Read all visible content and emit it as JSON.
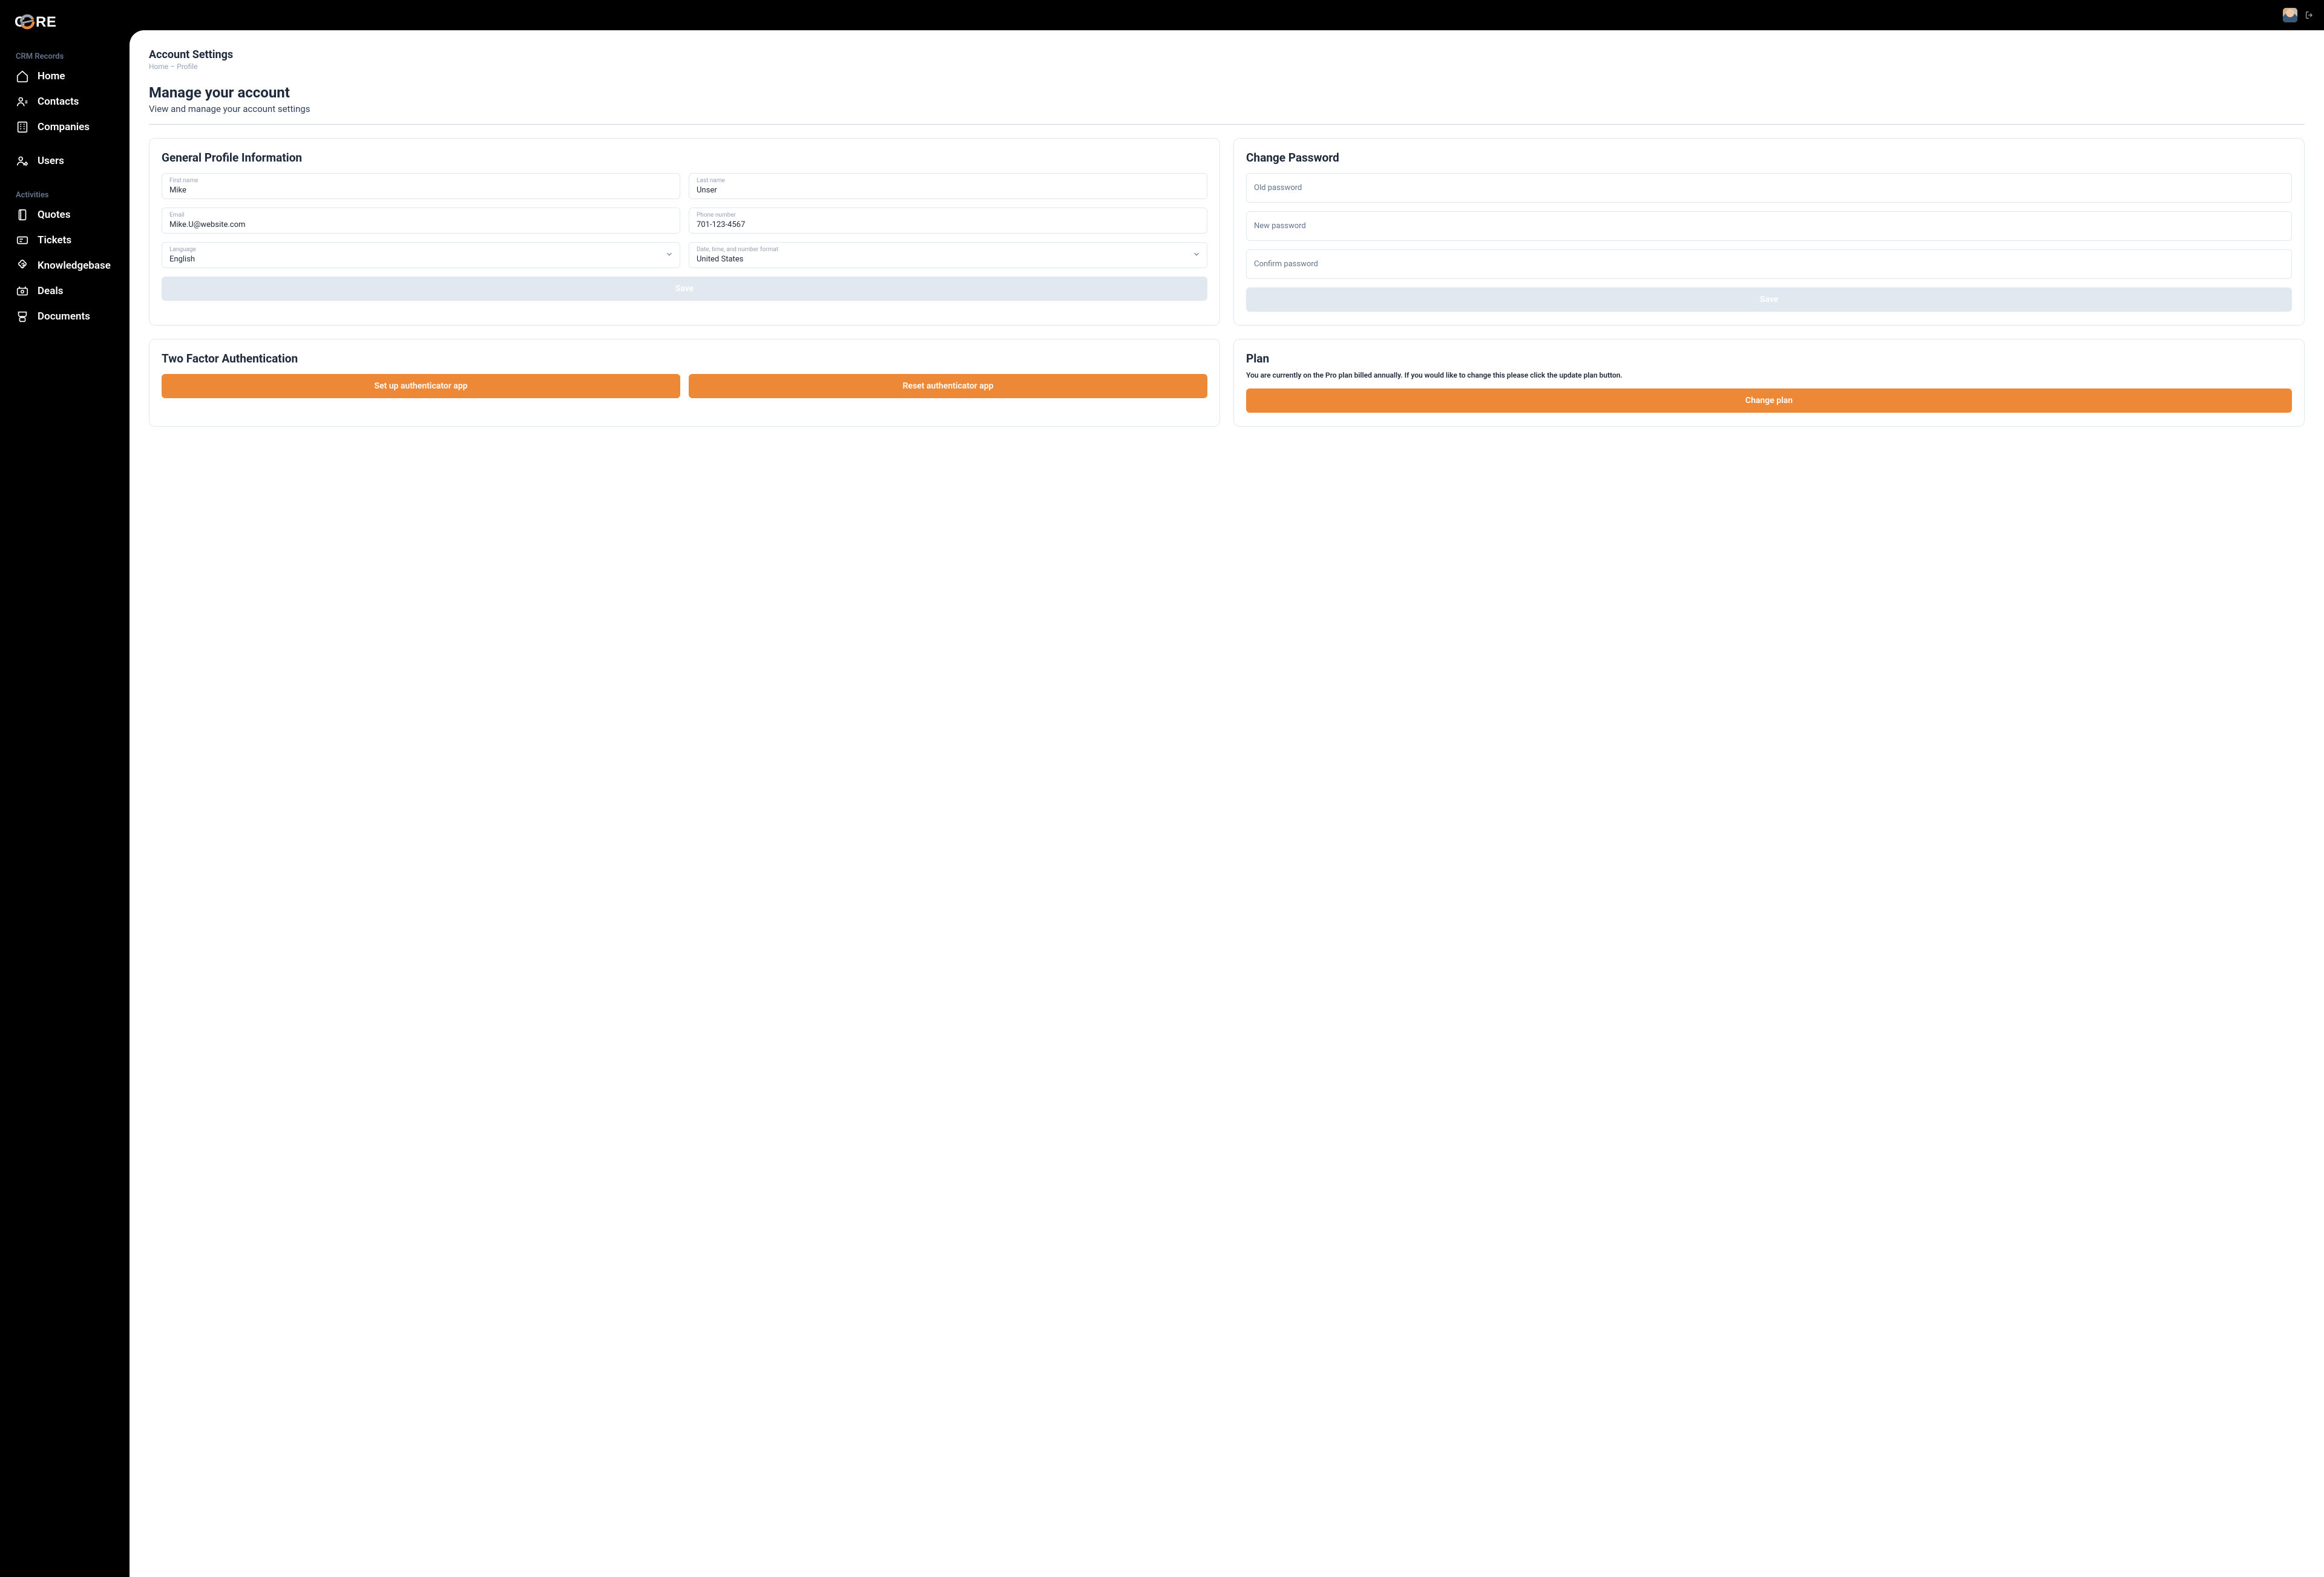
{
  "brand": {
    "name": "CORE"
  },
  "sidebar": {
    "section1_title": "CRM Records",
    "section2_title": "Activities",
    "items1": [
      {
        "label": "Home"
      },
      {
        "label": "Contacts"
      },
      {
        "label": "Companies"
      },
      {
        "label": "Users"
      }
    ],
    "items2": [
      {
        "label": "Quotes"
      },
      {
        "label": "Tickets"
      },
      {
        "label": "Knowledgebase"
      },
      {
        "label": "Deals"
      },
      {
        "label": "Documents"
      }
    ]
  },
  "header": {
    "page_title": "Account Settings",
    "breadcrumb_home": "Home",
    "breadcrumb_sep": " – ",
    "breadcrumb_current": "Profile",
    "heading": "Manage your account",
    "subheading": "View and manage your account settings"
  },
  "profile_card": {
    "title": "General Profile Information",
    "first_name_label": "First name",
    "first_name_value": "Mike",
    "last_name_label": "Last name",
    "last_name_value": "Unser",
    "email_label": "Email",
    "email_value": "Mike.U@website.com",
    "phone_label": "Phone number",
    "phone_value": "701-123-4567",
    "language_label": "Language",
    "language_value": "English",
    "locale_label": "Date, time, and number format",
    "locale_value": "United States",
    "save_label": "Save"
  },
  "password_card": {
    "title": "Change Password",
    "old_placeholder": "Old password",
    "new_placeholder": "New password",
    "confirm_placeholder": "Confirm password",
    "save_label": "Save"
  },
  "twofa_card": {
    "title": "Two Factor Authentication",
    "setup_label": "Set up authenticator app",
    "reset_label": "Reset authenticator app"
  },
  "plan_card": {
    "title": "Plan",
    "description": "You are currently on the Pro plan billed annually. If you would like to change this please click the update plan button.",
    "change_label": "Change plan"
  },
  "colors": {
    "accent": "#ed8936",
    "sidebar_bg": "#000000",
    "text": "#1e293b",
    "muted": "#94a3b8"
  }
}
